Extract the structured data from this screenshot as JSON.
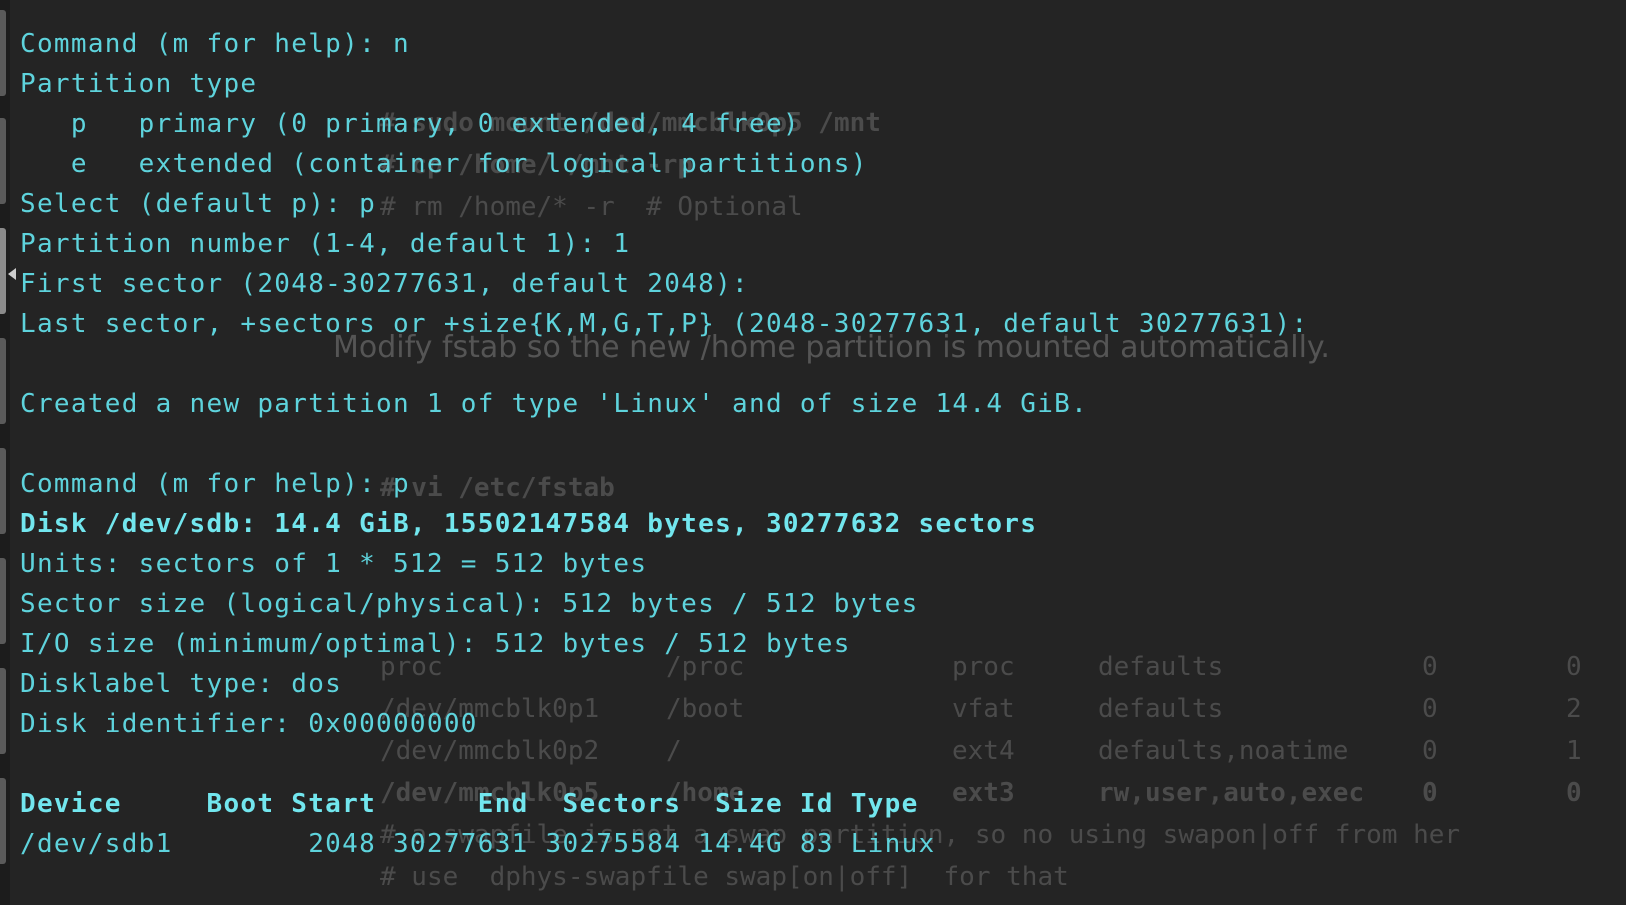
{
  "terminal": {
    "lines": {
      "l01": "Command (m for help): n",
      "l02": "Partition type",
      "l03": "   p   primary (0 primary, 0 extended, 4 free)",
      "l04": "   e   extended (container for logical partitions)",
      "l05": "Select (default p): p",
      "l06": "Partition number (1-4, default 1): 1",
      "l07": "First sector (2048-30277631, default 2048):",
      "l08": "Last sector, +sectors or +size{K,M,G,T,P} (2048-30277631, default 30277631):",
      "l10": "Created a new partition 1 of type 'Linux' and of size 14.4 GiB.",
      "l12": "Command (m for help): p",
      "l13": "Disk /dev/sdb: 14.4 GiB, 15502147584 bytes, 30277632 sectors",
      "l14": "Units: sectors of 1 * 512 = 512 bytes",
      "l15": "Sector size (logical/physical): 512 bytes / 512 bytes",
      "l16": "I/O size (minimum/optimal): 512 bytes / 512 bytes",
      "l17": "Disklabel type: dos",
      "l18": "Disk identifier: 0x00000000",
      "l20": "Device     Boot Start      End  Sectors  Size Id Type",
      "l21": "/dev/sdb1        2048 30277631 30275584 14.4G 83 Linux"
    }
  },
  "background_doc": {
    "code1": "# sudo mount /dev/mmcblk0p5 /mnt",
    "code2": "# cp /home/ /mnt -rp",
    "code3": "# rm /home/* -r  # Optional",
    "caption": "Modify fstab so the new /home partition is mounted automatically.",
    "vi_cmd": "# vi /etc/fstab",
    "fstab": [
      [
        "proc",
        "/proc",
        "proc",
        "defaults",
        "0",
        "0"
      ],
      [
        "/dev/mmcblk0p1",
        "/boot",
        "vfat",
        "defaults",
        "0",
        "2"
      ],
      [
        "/dev/mmcblk0p2",
        "/",
        "ext4",
        "defaults,noatime",
        "0",
        "1"
      ],
      [
        "/dev/mmcblk0p5",
        "/home",
        "ext3",
        "rw,user,auto,exec",
        "0",
        "0"
      ]
    ],
    "comment1": "# a swapfile is not a swap partition, so no using swapon|off from her",
    "comment2": "# use  dphys-swapfile swap[on|off]  for that"
  },
  "colors": {
    "background": "#242424",
    "terminal_text": "#5ed3dc",
    "ghost_text": "#4b4b4b"
  }
}
